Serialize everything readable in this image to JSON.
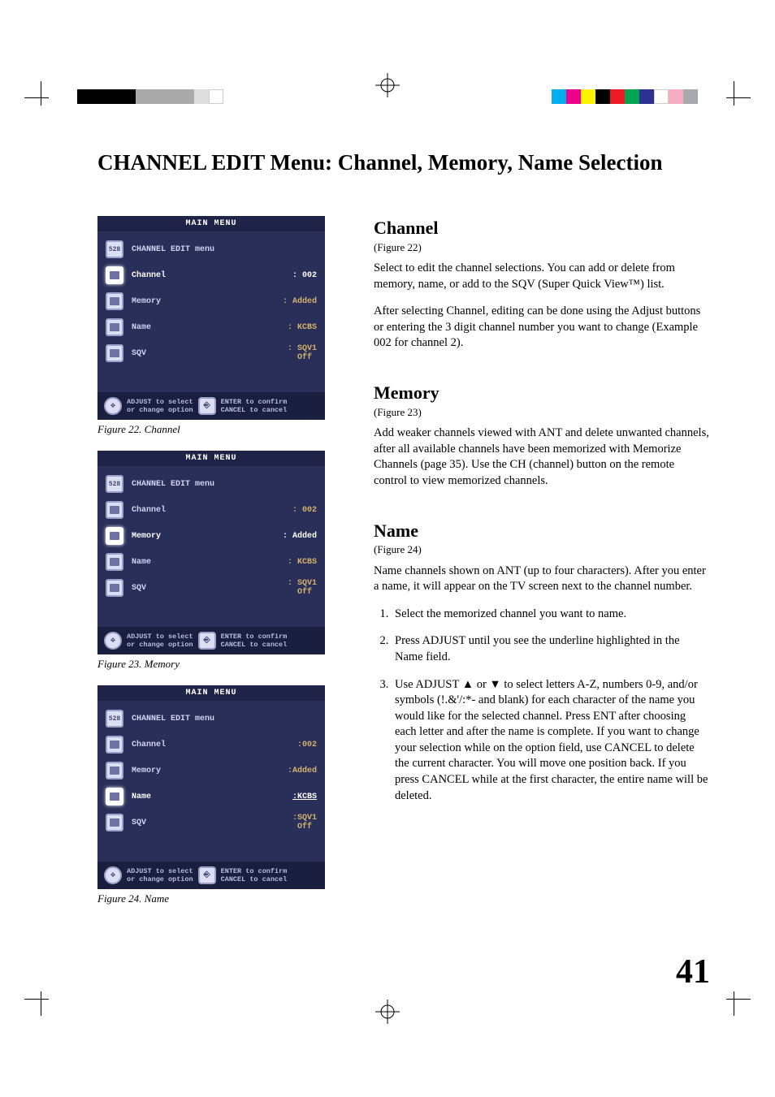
{
  "page": {
    "title": "CHANNEL EDIT Menu: Channel, Memory, Name Selection",
    "number": "41"
  },
  "swatches_left": [
    "#000",
    "#000",
    "#000",
    "#000",
    "#aaa",
    "#aaa",
    "#aaa",
    "#aaa",
    "#ddd",
    "#fff"
  ],
  "swatches_right": [
    "#00adee",
    "#ec008c",
    "#fff200",
    "#000",
    "#ed1c24",
    "#00a651",
    "#2e3192",
    "#fff",
    "#f7adc3",
    "#a7a9ac"
  ],
  "menu_common": {
    "title": "MAIN MENU",
    "menu_label": "CHANNEL EDIT menu",
    "rows": {
      "channel": "Channel",
      "memory": "Memory",
      "name": "Name",
      "sqv": "SQV"
    },
    "vals": {
      "channel": ": 002",
      "memory": ": Added",
      "name": ": KCBS",
      "sqv1": ": SQV1",
      "sqv_off": "  Off",
      "channel3": ":002",
      "memory3": ":Added",
      "name3": ":KCBS",
      "sqv13": ":SQV1",
      "sqv_off3": " Off"
    },
    "hint": {
      "adjust": "ADJUST to select",
      "change": "or change option",
      "enter": "ENTER to confirm",
      "cancel": "CANCEL to cancel"
    }
  },
  "captions": {
    "f22": "Figure 22.  Channel",
    "f23": "Figure 23.  Memory",
    "f24": "Figure 24.  Name"
  },
  "right": {
    "channel": {
      "h": "Channel",
      "ref": "(Figure 22)",
      "p1": "Select to edit the channel selections.  You can add or delete from memory, name, or add to the SQV (Super Quick View™) list.",
      "p2": "After selecting Channel, editing can be done using the Adjust buttons or entering the 3 digit channel number you want to change (Example 002 for channel 2)."
    },
    "memory": {
      "h": "Memory",
      "ref": "(Figure 23)",
      "p1": "Add weaker channels viewed with ANT and delete unwanted channels, after all available channels have been memorized with Memorize Channels (page 35).  Use the CH (channel) button on the remote control to view memorized channels."
    },
    "name": {
      "h": "Name",
      "ref": "(Figure 24)",
      "p1": "Name channels shown on ANT (up to four characters).  After you enter a name, it will appear on the TV screen next to the channel number.",
      "li1": "Select the memorized channel you want to name.",
      "li2": "Press ADJUST until you see the underline highlighted in the Name field.",
      "li3a": "Use ADJUST ",
      "li3b": " or ",
      "li3c": " to select letters A-Z, numbers 0-9, and/or symbols (!.&'/:*- and blank) for each character of the name you would like for the selected channel.  Press ENT after choosing each letter and after the name is complete. If you want to change your selection while on the option field, use CANCEL to delete the current character. You will move one position back.  If you press CANCEL while at the first character, the entire name will be deleted."
    }
  }
}
